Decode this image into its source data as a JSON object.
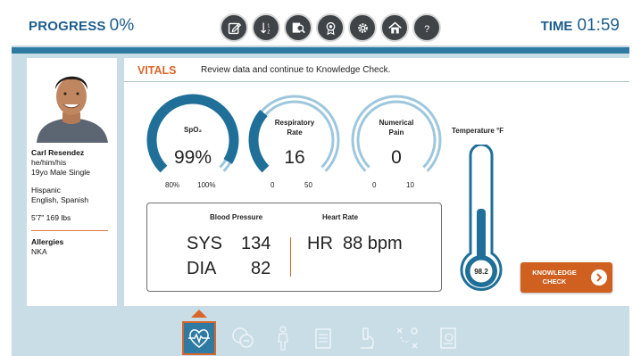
{
  "header": {
    "progress_label": "PROGRESS",
    "progress_value": "0%",
    "time_label": "TIME",
    "time_value": "01:59",
    "tools": [
      "notes-icon",
      "sort-icon",
      "search-person-icon",
      "award-icon",
      "settings-icon",
      "home-icon",
      "help-icon"
    ]
  },
  "patient": {
    "name": "Carl Resendez",
    "pronouns": "he/him/his",
    "demographics": "19yo   Male   Single",
    "ethnicity": "Hispanic",
    "languages": "English, Spanish",
    "height_weight": "5'7\"     169 lbs",
    "allergies_label": "Allergies",
    "allergies_value": "NKA"
  },
  "vitals": {
    "title": "VITALS",
    "instruction": "Review data and continue to Knowledge Check.",
    "spo2": {
      "label": "SpO₂",
      "value": "99%",
      "min": "80%",
      "max": "100%",
      "fraction": 0.95
    },
    "resp": {
      "label_line1": "Respiratory",
      "label_line2": "Rate",
      "value": "16",
      "min": "0",
      "max": "50",
      "fraction": 0.32
    },
    "pain": {
      "label_line1": "Numerical",
      "label_line2": "Pain",
      "value": "0",
      "min": "0",
      "max": "10",
      "fraction": 0.0
    },
    "temperature": {
      "label": "Temperature °F",
      "value": "98.2"
    },
    "bp": {
      "label": "Blood Pressure",
      "sys_label": "SYS",
      "sys_value": "134",
      "dia_label": "DIA",
      "dia_value": "82"
    },
    "hr": {
      "label": "Heart Rate",
      "text": "HR  88 bpm"
    },
    "knowledge_button": {
      "line1": "KNOWLEDGE",
      "line2": "CHECK"
    }
  },
  "colors": {
    "brand_blue": "#1d5d8c",
    "gauge_fill": "#1f6f98",
    "gauge_track": "#9ec7dd",
    "accent_orange": "#d8662a"
  },
  "nav": [
    "vitals-heart-icon",
    "chat-icon",
    "body-icon",
    "clipboard-icon",
    "microscope-icon",
    "strategy-icon",
    "document-icon"
  ]
}
